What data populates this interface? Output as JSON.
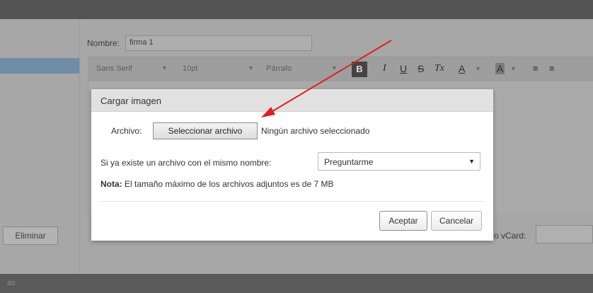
{
  "background": {
    "footer_text": "as",
    "name_label": "Nombre:",
    "name_value": "firma 1",
    "toolbar": {
      "font": "Sans Serif",
      "size": "10pt",
      "format": "Párrafo",
      "bold": "B",
      "italic": "I",
      "underline": "U",
      "strike": "S",
      "clear_format": "Tx",
      "text_color": "A",
      "bg_color": "A"
    },
    "delete_button": "Eliminar",
    "vcard_label": "o vCard:"
  },
  "dialog": {
    "title": "Cargar imagen",
    "file_label": "Archivo:",
    "file_button": "Seleccionar archivo",
    "file_status": "Ningún archivo seleccionado",
    "exists_label": "Si ya existe un archivo con el mismo nombre:",
    "exists_select_value": "Preguntarme",
    "note_label": "Nota:",
    "note_text": " El tamaño máximo de los archivos adjuntos es de 7 MB",
    "accept_button": "Aceptar",
    "cancel_button": "Cancelar"
  },
  "colors": {
    "overlay": "#a7a7a7",
    "arrow": "#e02020",
    "dialog_header": "#e1e1e1"
  }
}
